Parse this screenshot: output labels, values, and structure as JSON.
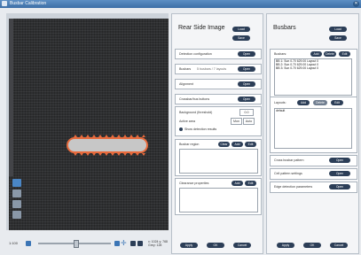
{
  "window": {
    "title": "Busbar Calibration"
  },
  "zoom": {
    "label": "1:100",
    "status": "x: 1024  y: 768  Grey: 128"
  },
  "rear_side": {
    "title": "Rear Side Image",
    "load_label": "Load",
    "save_label": "Save",
    "detection_config": {
      "label": "Detection configuration",
      "button": "Open"
    },
    "busbars": {
      "label": "Busbars",
      "value": "5 busbars / 7 layouts",
      "button": "Open"
    },
    "alignment": {
      "label": "Alignment",
      "button": "Open"
    },
    "crossbars": {
      "label": "Crossbar/bus buttons",
      "button": "Open"
    },
    "background": {
      "label": "Background (threshold)",
      "value": "0.0",
      "row2_label": "Active area",
      "opt1": "Mon",
      "opt2": "Auto",
      "show_label": "Show detection results"
    },
    "busbar_region": {
      "label": "Busbar region",
      "btn_clear": "Clear",
      "btn_add": "Add",
      "btn_edit": "Edit"
    },
    "clearance": {
      "label": "Clearance properties",
      "btn_add": "Add",
      "btn_edit": "Edit"
    },
    "apply_label": "Apply",
    "ok_label": "OK",
    "cancel_label": "Cancel"
  },
  "busbars_panel": {
    "title": "Busbars",
    "load_label": "Load",
    "save_label": "Save",
    "busbars_label": "Busbars:",
    "btn_add": "Add",
    "btn_delete": "Delete",
    "btn_edit": "Edit",
    "list_items": [
      "BB 1: Sun 0.70 629.00 Layout 0",
      "BB 2: Sun 0.70 629.00 Layout 0",
      "BB 3: Sun 0.70 629.00 Layout 0"
    ],
    "layouts_label": "Layouts:",
    "layout_add": "Add",
    "layout_delete": "Delete",
    "layout_edit": "Edit",
    "layout_items": [
      "default"
    ],
    "cross_busbar_label": "Cross busbar pattern",
    "cross_busbar_button": "Open",
    "cell_overlay_label": "Cell pattern settings",
    "cell_overlay_button": "Open",
    "edge_detection_label": "Edge detection parameters",
    "edge_detection_button": "Open",
    "apply_label": "Apply",
    "ok_label": "OK",
    "cancel_label": "Cancel"
  },
  "colors": {
    "accent": "#2c3e57",
    "title_bar": "#3d6fa6",
    "busbar_outline": "#e86b3d"
  }
}
